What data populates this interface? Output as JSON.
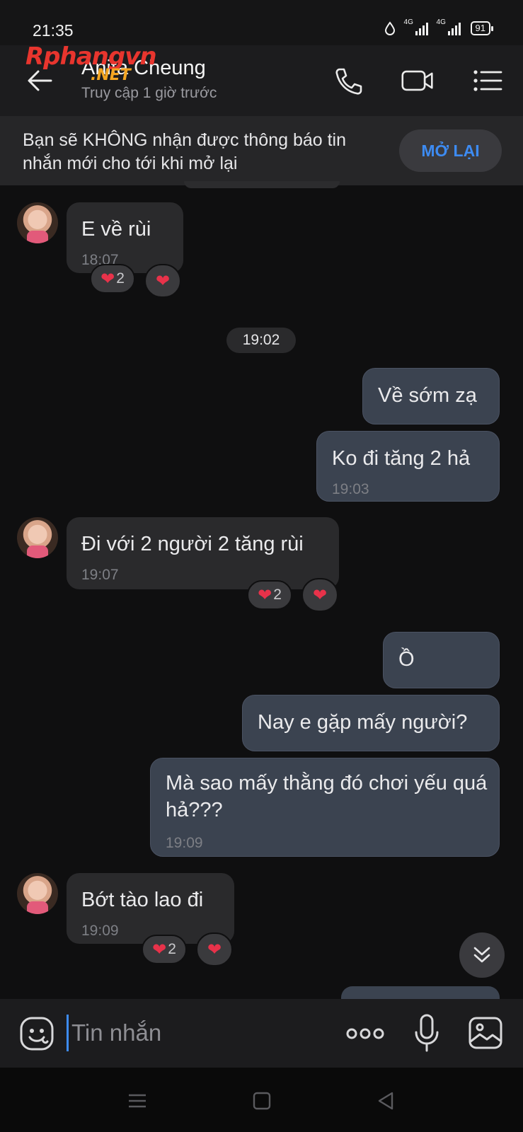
{
  "status_bar": {
    "time": "21:35",
    "network1": "4G",
    "network2": "4G",
    "battery": "91"
  },
  "header": {
    "contact_name": "Anita Cheung",
    "last_seen": "Truy cập 1 giờ trước",
    "watermark_main": "Rphangvn",
    "watermark_sub": ".NET",
    "icons": [
      "back-arrow-icon",
      "phone-icon",
      "video-camera-icon",
      "menu-list-icon"
    ]
  },
  "notice": {
    "text": "Bạn sẽ KHÔNG nhận được thông báo tin nhắn mới cho tới khi mở lại",
    "button": "MỞ LẠI"
  },
  "messages": [
    {
      "side": "in",
      "text": "E về rùi",
      "time": "18:07",
      "reaction_count": "2"
    },
    {
      "date_separator": "19:02"
    },
    {
      "side": "out",
      "text": "Về sớm zạ"
    },
    {
      "side": "out",
      "text": "Ko đi tăng 2 hả",
      "time": "19:03"
    },
    {
      "side": "in",
      "text": "Đi với 2 người 2 tăng rùi",
      "time": "19:07",
      "reaction_count": "2"
    },
    {
      "side": "out",
      "text": "Ồ"
    },
    {
      "side": "out",
      "text": "Nay e gặp mấy người?"
    },
    {
      "side": "out",
      "text": "Mà sao mấy thằng đó chơi yếu quá hả???",
      "time": "19:09"
    },
    {
      "side": "in",
      "text": "Bớt tào lao đi",
      "time": "19:09",
      "reaction_count": "2"
    }
  ],
  "composer": {
    "placeholder": "Tin nhắn",
    "icons": [
      "emoji-icon",
      "more-options-icon",
      "microphone-icon",
      "image-icon"
    ]
  },
  "colors": {
    "accent": "#3d8bf2",
    "heart": "#e8324a",
    "incoming_bubble": "#2a2a2c",
    "outgoing_bubble": "#3b4350",
    "background": "#0f0f10"
  }
}
